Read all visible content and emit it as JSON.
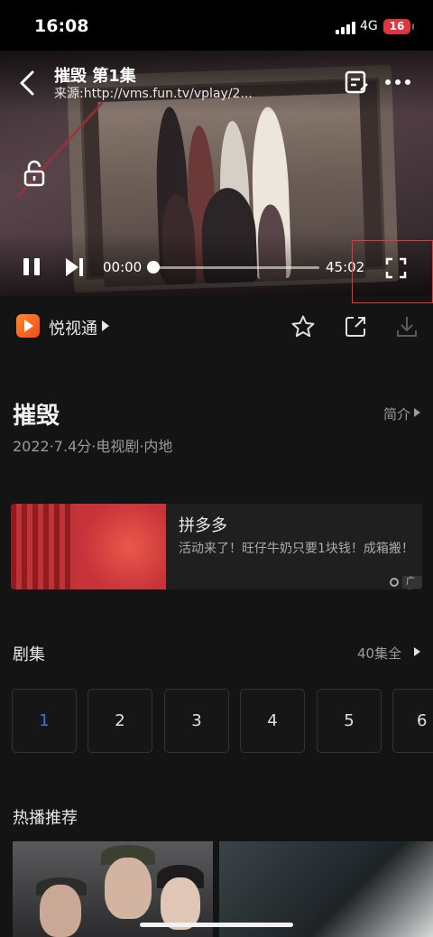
{
  "status_bar": {
    "time": "16:08",
    "network": "4G",
    "battery": "16"
  },
  "player": {
    "title": "摧毁 第1集",
    "source": "来源:http://vms.fun.tv/vplay/2...",
    "current_time": "00:00",
    "duration": "45:02",
    "progress": 0,
    "icons": [
      "back-icon",
      "edit-icon",
      "more-icon",
      "lock-icon",
      "pause-icon",
      "next-icon",
      "fullscreen-icon"
    ]
  },
  "provider": {
    "name": "悦视通"
  },
  "show": {
    "title": "摧毁",
    "meta": "2022·7.4分·电视剧·内地",
    "intro_label": "简介"
  },
  "ad": {
    "title": "拼多多",
    "description": "活动来了！旺仔牛奶只要1块钱！成箱搬！",
    "badge": "广告"
  },
  "episodes": {
    "title": "剧集",
    "total_label": "40集全",
    "items": [
      "1",
      "2",
      "3",
      "4",
      "5",
      "6"
    ],
    "selected": "1"
  },
  "recommend": {
    "title": "热播推荐"
  },
  "colors": {
    "accent": "#2f7bd8",
    "background": "#141414",
    "highlight": "#e33333"
  }
}
